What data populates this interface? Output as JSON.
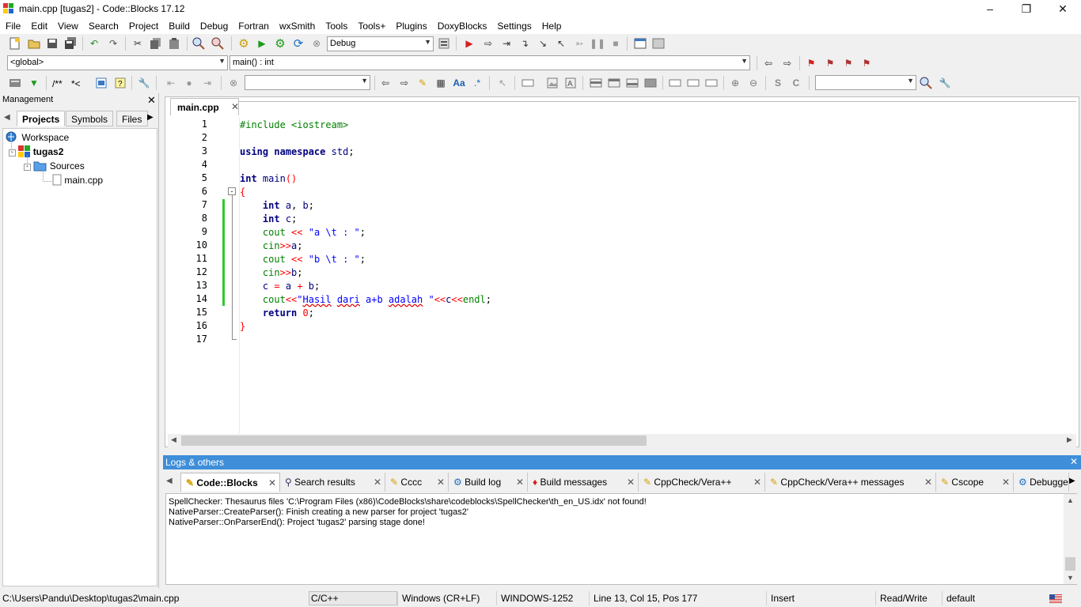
{
  "window": {
    "title": "main.cpp [tugas2] - Code::Blocks 17.12"
  },
  "menu": [
    "File",
    "Edit",
    "View",
    "Search",
    "Project",
    "Build",
    "Debug",
    "Fortran",
    "wxSmith",
    "Tools",
    "Tools+",
    "Plugins",
    "DoxyBlocks",
    "Settings",
    "Help"
  ],
  "toolbar": {
    "build_target": "Debug",
    "scope": "<global>",
    "function": "main() : int",
    "doxy_comment": "/**",
    "doxy_line": "*<"
  },
  "management": {
    "title": "Management",
    "tabs": [
      "Projects",
      "Symbols",
      "Files"
    ],
    "tree": {
      "workspace": "Workspace",
      "project": "tugas2",
      "folder": "Sources",
      "file": "main.cpp"
    }
  },
  "editor": {
    "tab": "main.cpp",
    "line_numbers": [
      "1",
      "2",
      "3",
      "4",
      "5",
      "6",
      "7",
      "8",
      "9",
      "10",
      "11",
      "12",
      "13",
      "14",
      "15",
      "16",
      "17"
    ]
  },
  "logs": {
    "title": "Logs & others",
    "tabs": [
      "Code::Blocks",
      "Search results",
      "Cccc",
      "Build log",
      "Build messages",
      "CppCheck/Vera++",
      "CppCheck/Vera++ messages",
      "Cscope",
      "Debugge"
    ],
    "lines": [
      "SpellChecker: Thesaurus files 'C:\\Program Files (x86)\\CodeBlocks\\share\\codeblocks\\SpellChecker\\th_en_US.idx' not found!",
      "NativeParser::CreateParser(): Finish creating a new parser for project 'tugas2'",
      "NativeParser::OnParserEnd(): Project 'tugas2' parsing stage done!"
    ]
  },
  "status": {
    "path": "C:\\Users\\Pandu\\Desktop\\tugas2\\main.cpp",
    "language": "C/C++",
    "eol": "Windows (CR+LF)",
    "encoding": "WINDOWS-1252",
    "position": "Line 13, Col 15, Pos 177",
    "mode": "Insert",
    "access": "Read/Write",
    "profile": "default"
  },
  "colors": {
    "accent": "#3e8ed9",
    "keyword": "#00007f",
    "preprocessor": "#007f00",
    "string": "#0000ff",
    "operator": "#ff0000",
    "change_bar": "#32c832"
  }
}
